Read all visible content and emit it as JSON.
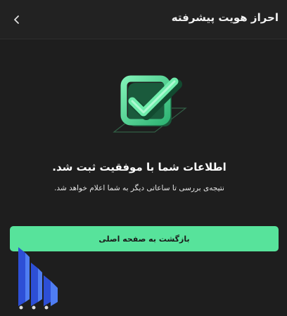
{
  "header": {
    "title": "احراز هویت پیشرفته",
    "back_icon": "chevron-left-icon"
  },
  "illustration": {
    "icon": "check-badge-icon",
    "accent_color": "#57e39b"
  },
  "message": {
    "title": "اطلاعات شما با موفقیت ثبت شد.",
    "subtitle": "نتیجه‌ی بررسی تا ساعاتی دیگر به شما اعلام خواهد شد."
  },
  "actions": {
    "home_button_label": "بازگشت به صفحه اصلی",
    "home_button_color": "#57e39b"
  },
  "colors": {
    "background": "#1e1e1e",
    "header_background": "#222222"
  }
}
